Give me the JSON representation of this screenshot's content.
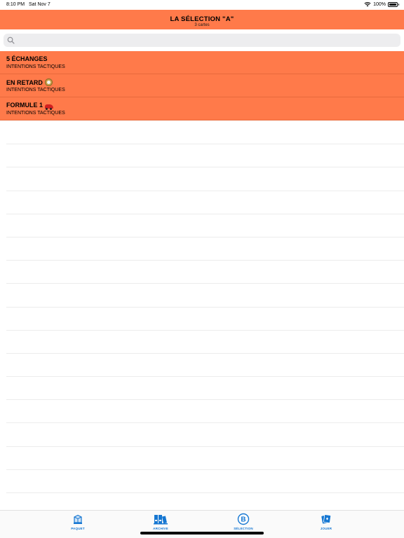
{
  "status_bar": {
    "time": "8:10 PM",
    "date": "Sat Nov 7",
    "battery": "100%",
    "battery_level": 1.0
  },
  "header": {
    "title": "LA SÉLECTION \"A\"",
    "subtitle": "3 cartes"
  },
  "search": {
    "icon": "magnifier-icon",
    "placeholder": "",
    "value": ""
  },
  "list": {
    "items": [
      {
        "title": "5 ÉCHANGES",
        "subtitle": "INTENTIONS TACTIQUES",
        "emoji": ""
      },
      {
        "title": "EN RETARD",
        "subtitle": "INTENTIONS TACTIQUES",
        "emoji": "clock-icon"
      },
      {
        "title": "FORMULE 1",
        "subtitle": "INTENTIONS TACTIQUES",
        "emoji": "race-car-icon"
      }
    ]
  },
  "tab_bar": {
    "tabs": [
      {
        "label": "PAQUET",
        "icon": "package-icon"
      },
      {
        "label": "ARCHIVE",
        "icon": "binders-icon"
      },
      {
        "label": "SÉLECTION",
        "icon": "b-circle-icon"
      },
      {
        "label": "JOUER",
        "icon": "cards-icon"
      }
    ]
  },
  "colors": {
    "accent": "#FF7A4A",
    "tab_tint": "#1677D2",
    "search_bg": "#EDEDEF"
  }
}
